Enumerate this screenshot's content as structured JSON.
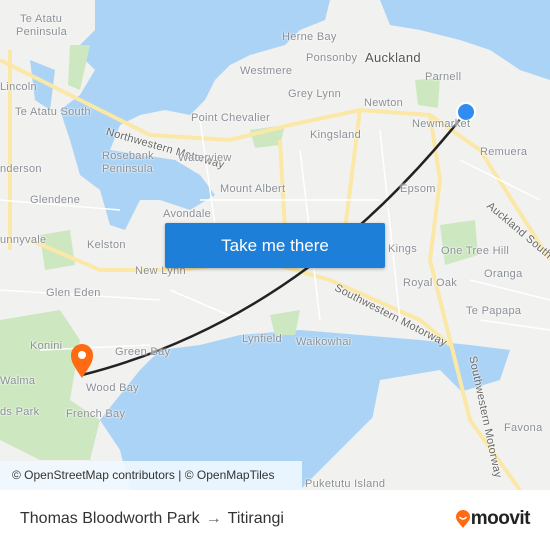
{
  "map": {
    "labels": {
      "te_atatu_peninsula_1": "Te Atatu",
      "te_atatu_peninsula_2": "Peninsula",
      "herne_bay": "Herne Bay",
      "auckland": "Auckland",
      "westmere": "Westmere",
      "ponsonby": "Ponsonby",
      "parnell": "Parnell",
      "lincoln": "Lincoln",
      "grey_lynn": "Grey Lynn",
      "newton": "Newton",
      "te_atatu_south": "Te Atatu South",
      "northwestern_motorway": "Northwestern Motorway",
      "point_chevalier": "Point Chevalier",
      "newmarket": "Newmarket",
      "kingsland": "Kingsland",
      "remuera": "Remuera",
      "rosebank_1": "Rosebank",
      "rosebank_2": "Peninsula",
      "waterview": "Waterview",
      "henderson": "nderson",
      "mount_albert": "Mount Albert",
      "epsom": "Epsom",
      "glendene": "Glendene",
      "avondale": "Avondale",
      "auckland_southern": "Auckland Southern",
      "sunnyvale": "unnyvale",
      "kelston": "Kelston",
      "kings": "Kings",
      "one_tree_hill": "One Tree Hill",
      "new_lynn": "New Lynn",
      "oranga": "Oranga",
      "glen_eden": "Glen Eden",
      "royal_oak": "Royal Oak",
      "southwestern_motorway": "Southwestern Motorway",
      "te_papapa": "Te Papapa",
      "lynfield": "Lynfield",
      "waikowhai": "Waikowhai",
      "konini": "Konini",
      "green_bay": "Green Bay",
      "walma": "Walma",
      "wood_bay": "Wood Bay",
      "french_bay": "French Bay",
      "ds_park": "ds Park",
      "southwestern_motorway_2": "Southwestern Motorway",
      "favona": "Favona",
      "puketutu_island": "Puketutu Island"
    },
    "cta_label": "Take me there",
    "attribution": "© OpenStreetMap contributors | © OpenMapTiles",
    "origin_marker_color": "#2f8cf0",
    "destination_marker_color": "#ff6a13",
    "water_color": "#aad3f5",
    "park_color": "#cde8c0"
  },
  "footer": {
    "origin": "Thomas Bloodworth Park",
    "arrow": "→",
    "destination": "Titirangi",
    "logo_text": "moovit",
    "logo_color": "#ff6a13"
  }
}
